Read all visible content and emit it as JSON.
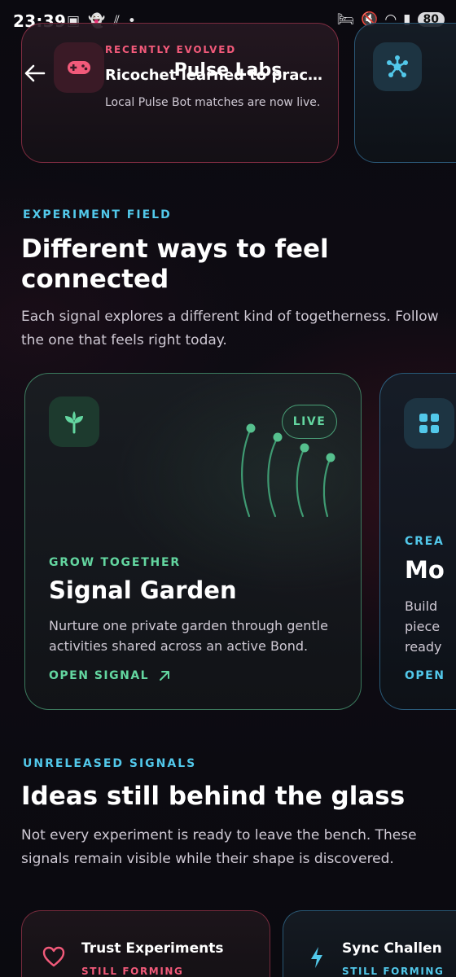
{
  "status_bar": {
    "time": "23:39",
    "battery": "80"
  },
  "header": {
    "title": "Pulse Labs"
  },
  "evolved": {
    "kicker": "RECENTLY EVOLVED",
    "title": "Ricochet learned to practice",
    "description": "Local Pulse Bot matches are now live."
  },
  "section_field": {
    "kicker": "EXPERIMENT FIELD",
    "title": "Different ways to feel connected",
    "description": "Each signal explores a different kind of togetherness. Follow the one that feels right today."
  },
  "garden_card": {
    "badge": "LIVE",
    "kicker": "GROW TOGETHER",
    "title": "Signal Garden",
    "description": "Nurture one private garden through gentle activities shared across an active Bond.",
    "link": "OPEN SIGNAL"
  },
  "next_card": {
    "kicker": "CREA",
    "title": "Mo",
    "description_lines": [
      "Build",
      "piece",
      "ready"
    ],
    "link": "OPEN"
  },
  "section_unreleased": {
    "kicker": "UNRELEASED SIGNALS",
    "title": "Ideas still behind the glass",
    "description": "Not every experiment is ready to leave the bench. These signals remain visible while their shape is discovered."
  },
  "unreleased_cards": [
    {
      "title": "Trust Experiments",
      "kicker": "STILL FORMING"
    },
    {
      "title": "Sync Challen",
      "kicker": "STILL FORMING"
    }
  ],
  "colors": {
    "accent_rose": "#f25a7a",
    "accent_teal": "#52c8ea",
    "accent_green": "#63d6a0",
    "background": "#0c0a10"
  }
}
